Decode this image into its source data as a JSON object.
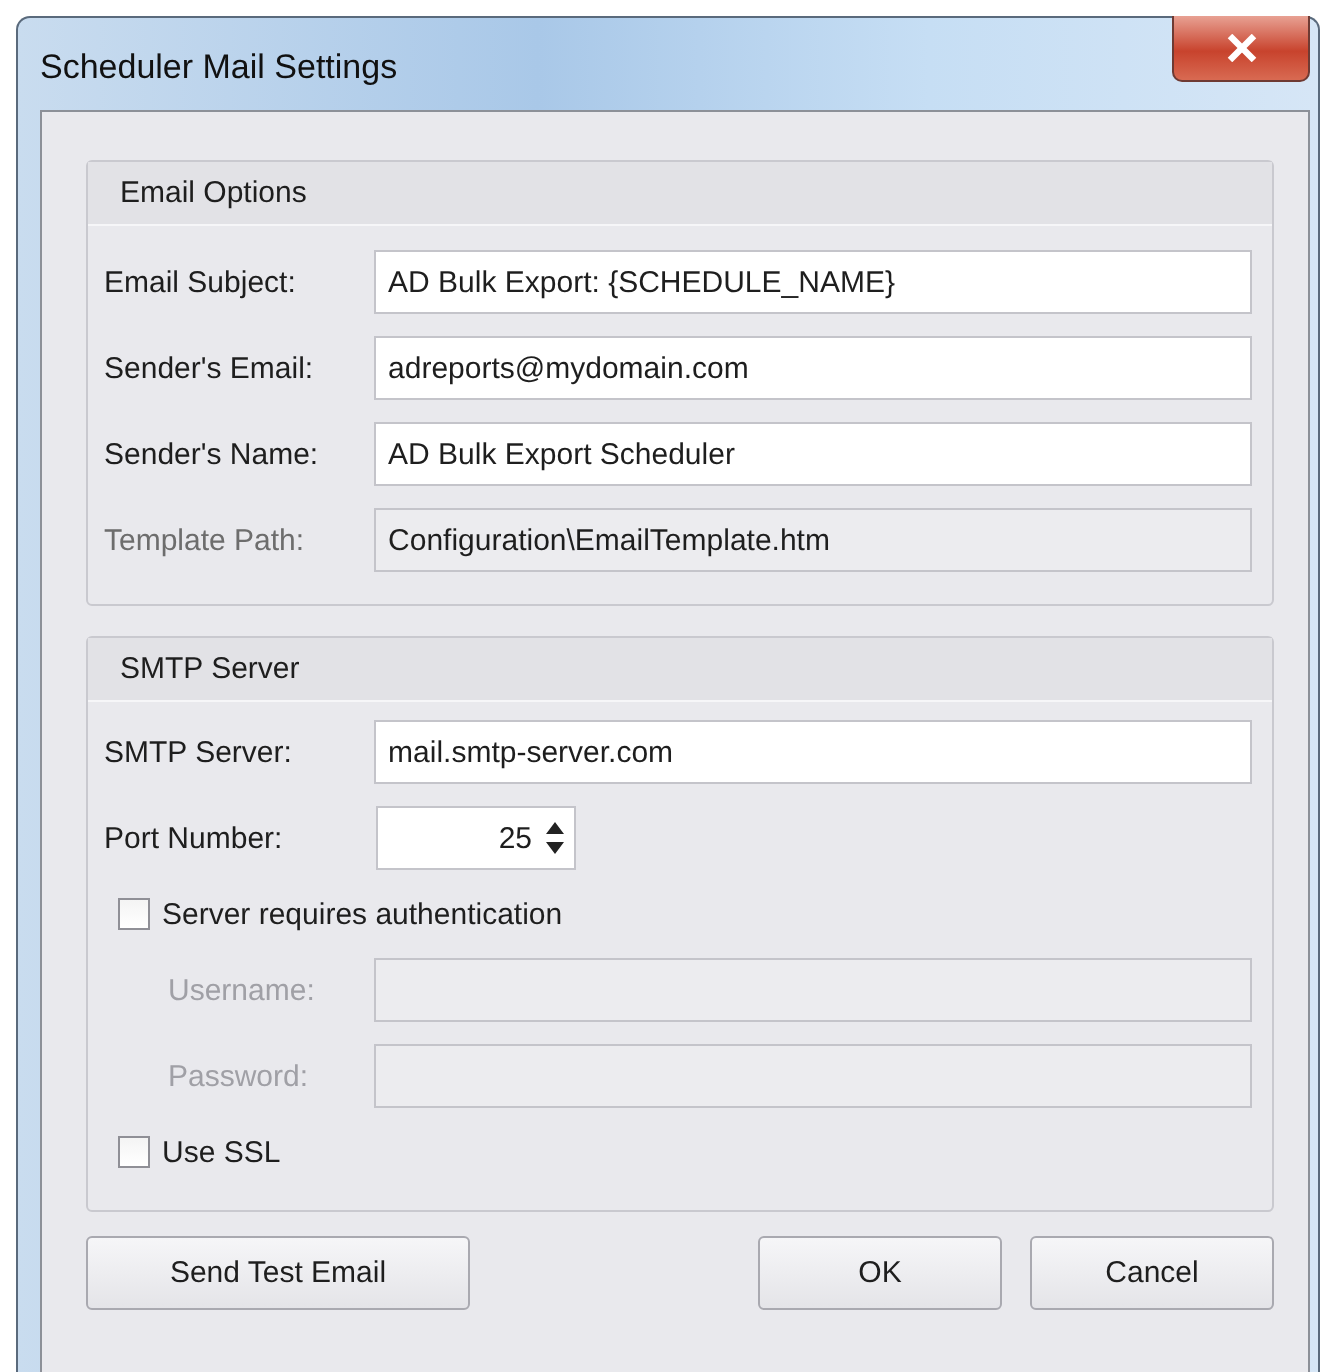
{
  "window": {
    "title": "Scheduler Mail Settings"
  },
  "email_options": {
    "title": "Email Options",
    "fields": [
      {
        "label": "Email Subject:",
        "value": "AD Bulk Export: {SCHEDULE_NAME}",
        "disabled": false
      },
      {
        "label": "Sender's Email:",
        "value": "adreports@mydomain.com",
        "disabled": false
      },
      {
        "label": "Sender's Name:",
        "value": "AD Bulk Export Scheduler",
        "disabled": false
      },
      {
        "label": "Template Path:",
        "value": "Configuration\\EmailTemplate.htm",
        "disabled": true
      }
    ]
  },
  "smtp_server": {
    "title": "SMTP Server",
    "server": {
      "label": "SMTP Server:",
      "value": "mail.smtp-server.com"
    },
    "port": {
      "label": "Port Number:",
      "value": "25"
    },
    "auth": {
      "label": "Server requires authentication",
      "checked": false
    },
    "credentials": [
      {
        "label": "Username:",
        "disabled": true
      },
      {
        "label": "Password:",
        "disabled": true
      }
    ],
    "ssl": {
      "label": "Use SSL",
      "checked": false
    }
  },
  "buttons": [
    {
      "label": "Send Test Email"
    },
    {
      "label": "OK"
    },
    {
      "label": "Cancel"
    }
  ]
}
